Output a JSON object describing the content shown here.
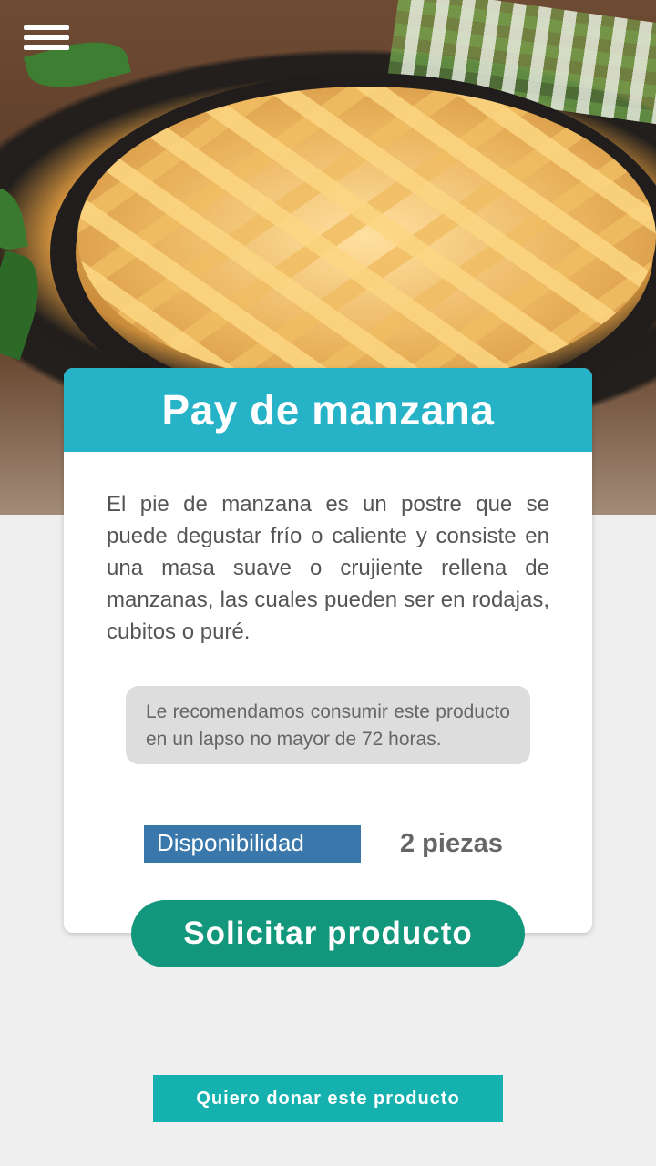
{
  "hero": {
    "image": "apple-pie-photo"
  },
  "menu": {
    "icon": "hamburger-menu-icon"
  },
  "product": {
    "title": "Pay de manzana",
    "description": "El pie de manzana es un postre que se puede degustar frío o caliente y consiste en una masa suave o crujiente rellena de manzanas, las cuales pueden ser en rodajas, cubitos o puré.",
    "notice": "Le recomendamos consumir este producto en un lapso no mayor de 72 horas.",
    "availability_label": "Disponibilidad",
    "availability_value": "2 piezas"
  },
  "actions": {
    "request_label": "Solicitar producto",
    "donate_label": "Quiero donar este producto"
  },
  "colors": {
    "header": "#26b3c8",
    "availability_badge": "#3a78ac",
    "request_button": "#12977c",
    "donate_button": "#14b1ae",
    "page_background": "#efefef"
  }
}
